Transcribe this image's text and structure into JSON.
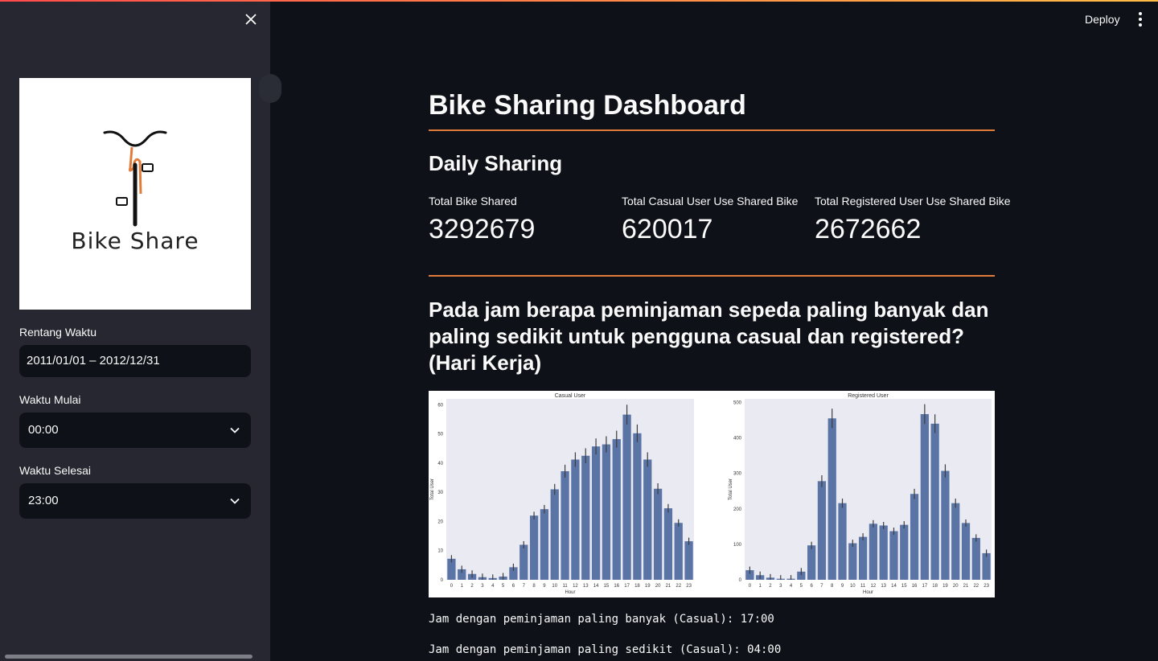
{
  "colors": {
    "accent": "#e07b3a",
    "bar": "#5a74a6",
    "sidebar_bg": "#262730",
    "main_bg": "#0e1117"
  },
  "sidebar": {
    "close_icon": "close-icon",
    "logo_text": "Bike Share",
    "date_range": {
      "label": "Rentang Waktu",
      "value": "2011/01/01 – 2012/12/31"
    },
    "start_time": {
      "label": "Waktu Mulai",
      "value": "00:00"
    },
    "end_time": {
      "label": "Waktu Selesai",
      "value": "23:00"
    }
  },
  "header": {
    "deploy_label": "Deploy",
    "menu_icon": "kebab-menu-icon"
  },
  "main": {
    "title": "Bike Sharing Dashboard",
    "daily_heading": "Daily Sharing",
    "metrics": [
      {
        "label": "Total Bike Shared",
        "value": "3292679"
      },
      {
        "label": "Total Casual User Use Shared Bike",
        "value": "620017"
      },
      {
        "label": "Total Registered User Use Shared Bike",
        "value": "2672662"
      }
    ],
    "question": "Pada jam berapa peminjaman sepeda paling banyak dan paling sedikit untuk pengguna casual dan registered? (Hari Kerja)",
    "result_most_casual": "Jam dengan peminjaman paling banyak (Casual): 17:00",
    "result_least_casual": "Jam dengan peminjaman paling sedikit (Casual): 04:00"
  },
  "chart_data": [
    {
      "type": "bar",
      "title": "Casual User",
      "xlabel": "Hour",
      "ylabel": "Total User",
      "categories": [
        "0",
        "1",
        "2",
        "3",
        "4",
        "5",
        "6",
        "7",
        "8",
        "9",
        "10",
        "11",
        "12",
        "13",
        "14",
        "15",
        "16",
        "17",
        "18",
        "19",
        "20",
        "21",
        "22",
        "23"
      ],
      "values": [
        7.2,
        3.6,
        2,
        0.9,
        0.6,
        1.1,
        4.3,
        12,
        22,
        24.2,
        31,
        37.2,
        41.2,
        42.5,
        45.7,
        46.4,
        48.2,
        56.6,
        50.2,
        41.2,
        31.2,
        24.5,
        19.5,
        13.2
      ],
      "ylim": [
        0,
        62
      ],
      "yticks": [
        0,
        10,
        20,
        30,
        40,
        50,
        60
      ]
    },
    {
      "type": "bar",
      "title": "Registered User",
      "xlabel": "Hour",
      "ylabel": "Total User",
      "categories": [
        "0",
        "1",
        "2",
        "3",
        "4",
        "5",
        "6",
        "7",
        "8",
        "9",
        "10",
        "11",
        "12",
        "13",
        "14",
        "15",
        "16",
        "17",
        "18",
        "19",
        "20",
        "21",
        "22",
        "23"
      ],
      "values": [
        27,
        13,
        6,
        3,
        3,
        23,
        97,
        278,
        455,
        216,
        103,
        121,
        158,
        153,
        137,
        155,
        242,
        467,
        440,
        307,
        216,
        160,
        118,
        75
      ],
      "ylim": [
        0,
        510
      ],
      "yticks": [
        0,
        100,
        200,
        300,
        400,
        500
      ]
    }
  ]
}
